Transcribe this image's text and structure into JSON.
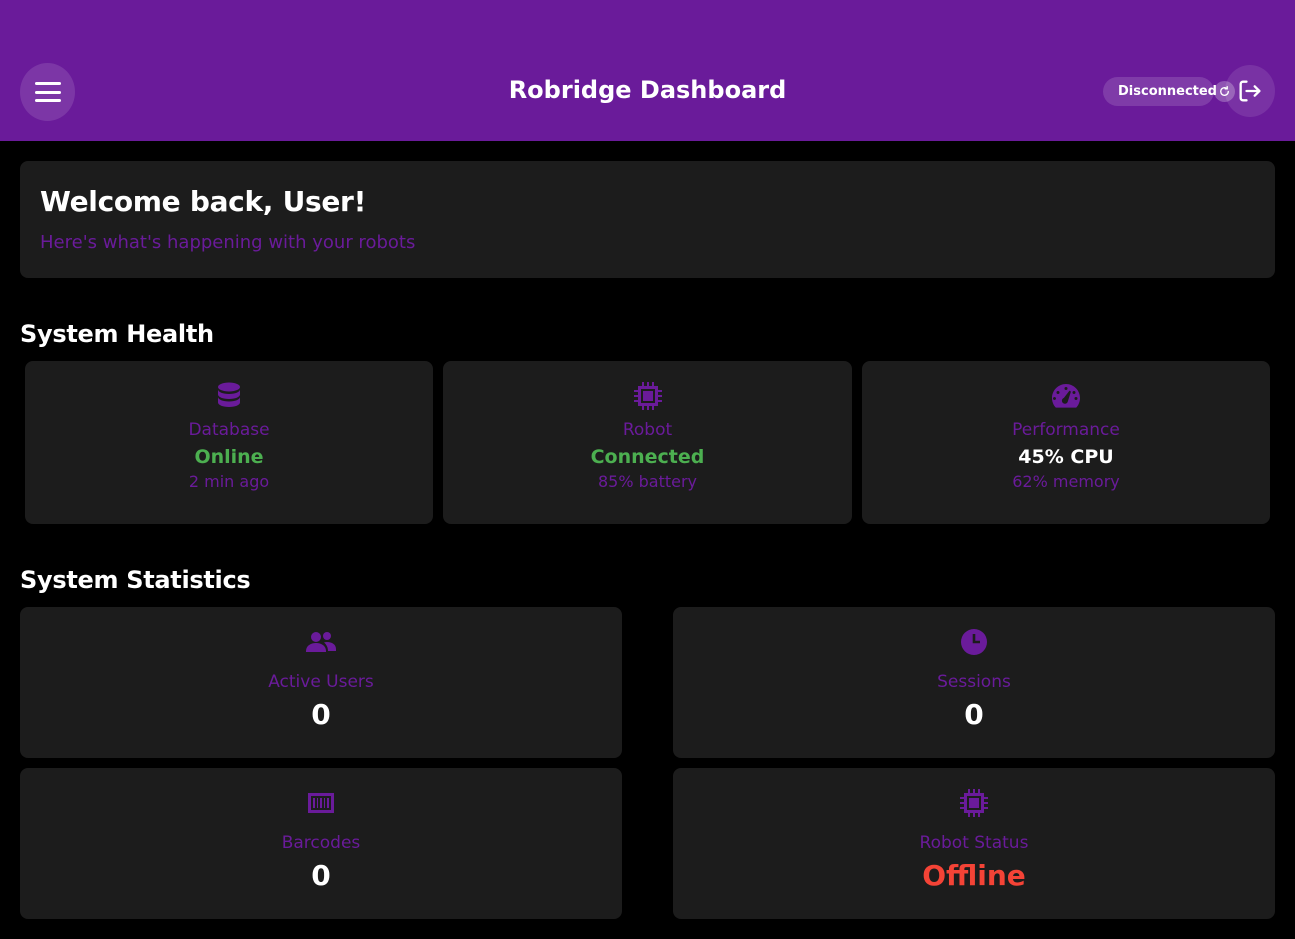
{
  "header": {
    "title": "Robridge Dashboard",
    "connection_status": "Disconnected",
    "connection_color": "#f44336",
    "menu_icon": "hamburger-menu-icon",
    "refresh_icon": "refresh-icon",
    "logout_icon": "logout-icon"
  },
  "welcome": {
    "title": "Welcome back, User!",
    "subtitle": "Here's what's happening with your robots"
  },
  "system_health": {
    "title": "System Health",
    "cards": [
      {
        "icon": "database-icon",
        "label": "Database",
        "value": "Online",
        "value_color": "#4caf50",
        "sub": "2 min ago"
      },
      {
        "icon": "chip-icon",
        "label": "Robot",
        "value": "Connected",
        "value_color": "#4caf50",
        "sub": "85% battery"
      },
      {
        "icon": "gauge-icon",
        "label": "Performance",
        "value": "45% CPU",
        "value_color": "#ffffff",
        "sub": "62% memory"
      }
    ]
  },
  "system_statistics": {
    "title": "System Statistics",
    "cards": [
      {
        "icon": "users-icon",
        "label": "Active Users",
        "value": "0",
        "value_color": "#ffffff"
      },
      {
        "icon": "clock-icon",
        "label": "Sessions",
        "value": "0",
        "value_color": "#ffffff"
      },
      {
        "icon": "barcode-icon",
        "label": "Barcodes",
        "value": "0",
        "value_color": "#ffffff"
      },
      {
        "icon": "chip-icon",
        "label": "Robot Status",
        "value": "Offline",
        "value_color": "#f44336"
      }
    ]
  },
  "colors": {
    "accent": "#6a1b9a",
    "card_background": "#1c1c1c",
    "page_background": "#000000",
    "success": "#4caf50",
    "error": "#f44336"
  }
}
